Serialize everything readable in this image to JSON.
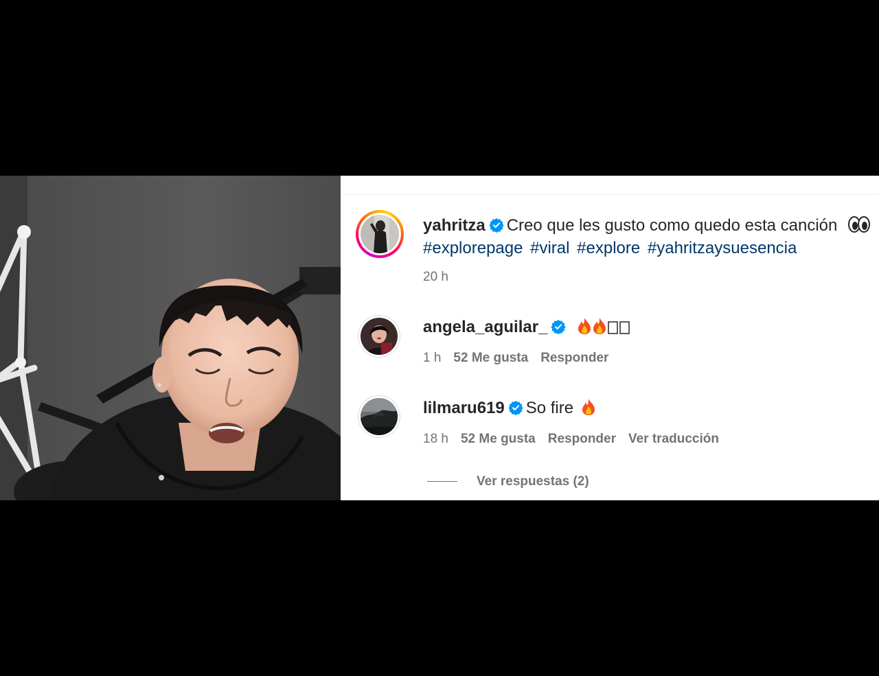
{
  "post": {
    "author": "yahritza",
    "caption": "Creo que les gusto como quedo esta canción",
    "hashtags": [
      "#explorepage",
      "#viral",
      "#explore",
      "#yahritzaysuesencia"
    ],
    "time": "20 h"
  },
  "comments": [
    {
      "author": "angela_aguilar_",
      "text": "",
      "emoji": "fire-fire-hearts",
      "time": "1 h",
      "likes": "52 Me gusta",
      "reply": "Responder"
    },
    {
      "author": "lilmaru619",
      "text": "So fire",
      "emoji": "fire",
      "time": "18 h",
      "likes": "52 Me gusta",
      "reply": "Responder",
      "translate": "Ver traducción"
    }
  ],
  "view_replies": "Ver respuestas (2)",
  "colors": {
    "verified": "#0095f6",
    "hashtag": "#00376b",
    "meta": "#737373",
    "text": "#262626"
  }
}
